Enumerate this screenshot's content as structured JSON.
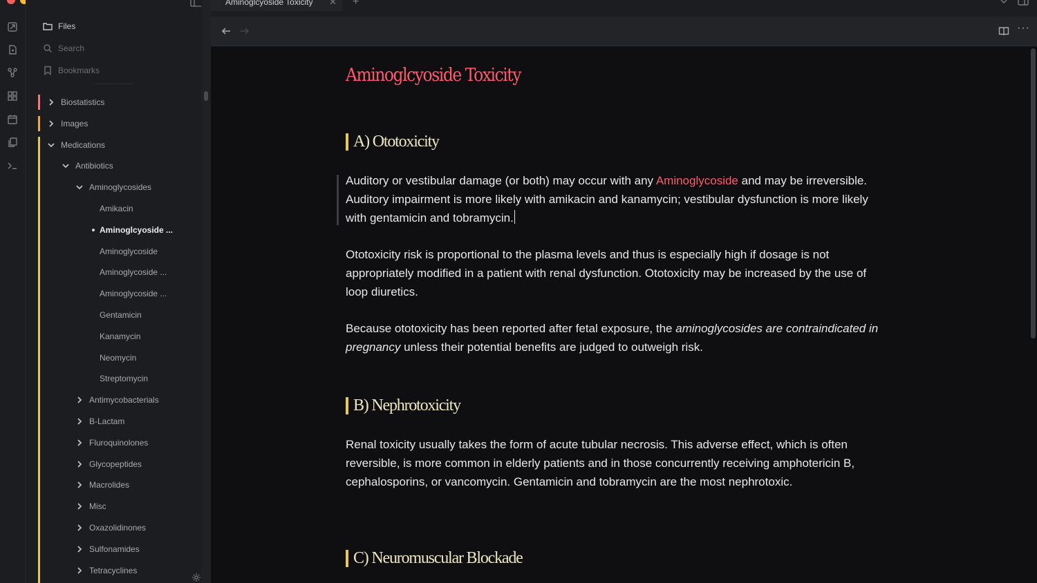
{
  "window": {
    "traffic_colors": [
      "#ff5f57",
      "#febc2e",
      "#28c840"
    ]
  },
  "tab": {
    "title": "Aminoglcyoside Toxicity",
    "close": "✕",
    "add": "+"
  },
  "sidebar": {
    "nav": {
      "files": "Files",
      "search": "Search",
      "bookmarks": "Bookmarks"
    },
    "tree": [
      {
        "label": "Biostatistics",
        "chev": "right",
        "bar": "#f7767e"
      },
      {
        "label": "Images",
        "chev": "right",
        "bar": "#f2a64a"
      },
      {
        "label": "Medications",
        "chev": "down",
        "bar": "#e7c757"
      },
      {
        "label": "Antibiotics",
        "chev": "down"
      },
      {
        "label": "Aminoglycosides",
        "chev": "down"
      },
      {
        "label": "Amikacin"
      },
      {
        "label": "Aminoglcyoside ...",
        "active": true
      },
      {
        "label": "Aminoglycoside"
      },
      {
        "label": "Aminoglycoside ..."
      },
      {
        "label": "Aminoglycoside ..."
      },
      {
        "label": "Gentamicin"
      },
      {
        "label": "Kanamycin"
      },
      {
        "label": "Neomycin"
      },
      {
        "label": "Streptomycin"
      },
      {
        "label": "Antimycobacterials",
        "chev": "right"
      },
      {
        "label": "B-Lactam",
        "chev": "right"
      },
      {
        "label": "Fluroquinolones",
        "chev": "right"
      },
      {
        "label": "Glycopeptides",
        "chev": "right"
      },
      {
        "label": "Macrolides",
        "chev": "right"
      },
      {
        "label": "Misc",
        "chev": "right"
      },
      {
        "label": "Oxazolidinones",
        "chev": "right"
      },
      {
        "label": "Sulfonamides",
        "chev": "right"
      },
      {
        "label": "Tetracyclines",
        "chev": "right"
      }
    ]
  },
  "view": {
    "more": "···"
  },
  "doc": {
    "title": "Aminoglcyoside Toxicity",
    "sections": [
      {
        "heading": "A) Ototoxicity"
      },
      {
        "heading": "B) Nephrotoxicity"
      },
      {
        "heading": "C) Neuromuscular Blockade"
      }
    ],
    "p1": {
      "before": "Auditory or vestibular damage (or both) may occur with any ",
      "link": "Aminoglycoside",
      "after": " and may be irreversible. Auditory impairment is more likely with amikacin and kanamycin; vestibular dysfunction is more likely with gentamicin and tobramycin."
    },
    "p2": "Ototoxicity risk is proportional to the plasma levels and thus is especially high if dosage is not appropriately modified in a patient with renal dysfunction. Ototoxicity may be increased by the use of loop diuretics.",
    "p3": {
      "before": "Because ototoxicity has been reported after fetal exposure, the ",
      "em": "aminoglycosides are contraindicated in pregnancy",
      "after": " unless their potential benefits are judged to outweigh risk."
    },
    "p4": "Renal toxicity usually takes the form of acute tubular necrosis. This adverse effect, which is often reversible, is more common in elderly patients and in those concurrently receiving amphotericin B, cephalosporins, or vancomycin. Gentamicin and tobramycin are the most nephrotoxic."
  }
}
